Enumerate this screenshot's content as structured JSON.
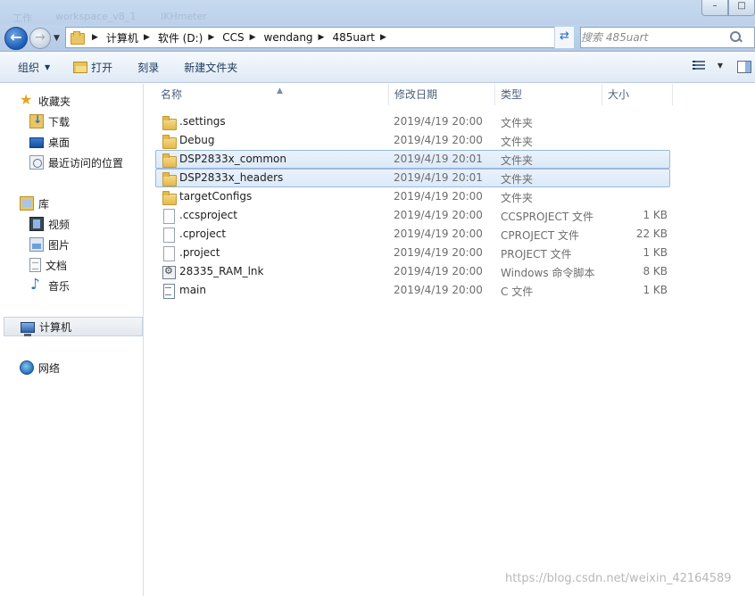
{
  "titlebar": {
    "faint_text": [
      "工作",
      "workspace_v8_1",
      "IKHmeter"
    ]
  },
  "window_controls": {
    "minimize": "–",
    "maximize": "□"
  },
  "address": {
    "breadcrumbs": [
      "计算机",
      "软件 (D:)",
      "CCS",
      "wendang",
      "485uart"
    ]
  },
  "search": {
    "placeholder": "搜索 485uart"
  },
  "toolbar": {
    "organize_label": "组织",
    "open_label": "打开",
    "burn_label": "刻录",
    "new_folder_label": "新建文件夹"
  },
  "sidebar": {
    "favorites_label": "收藏夹",
    "favorites": [
      "下载",
      "桌面",
      "最近访问的位置"
    ],
    "libraries_label": "库",
    "libraries": [
      "视频",
      "图片",
      "文档",
      "音乐"
    ],
    "computer_label": "计算机",
    "network_label": "网络"
  },
  "columns": {
    "name": "名称",
    "date": "修改日期",
    "type": "类型",
    "size": "大小"
  },
  "files": [
    {
      "name": ".settings",
      "date": "2019/4/19 20:00",
      "type": "文件夹",
      "size": "",
      "icon": "folder-icon",
      "selected": false
    },
    {
      "name": "Debug",
      "date": "2019/4/19 20:00",
      "type": "文件夹",
      "size": "",
      "icon": "folder-icon",
      "selected": false
    },
    {
      "name": "DSP2833x_common",
      "date": "2019/4/19 20:01",
      "type": "文件夹",
      "size": "",
      "icon": "folder-icon",
      "selected": true
    },
    {
      "name": "DSP2833x_headers",
      "date": "2019/4/19 20:01",
      "type": "文件夹",
      "size": "",
      "icon": "folder-icon",
      "selected": true
    },
    {
      "name": "targetConfigs",
      "date": "2019/4/19 20:00",
      "type": "文件夹",
      "size": "",
      "icon": "folder-icon",
      "selected": false
    },
    {
      "name": ".ccsproject",
      "date": "2019/4/19 20:00",
      "type": "CCSPROJECT 文件",
      "size": "1 KB",
      "icon": "page-icon",
      "selected": false
    },
    {
      "name": ".cproject",
      "date": "2019/4/19 20:00",
      "type": "CPROJECT 文件",
      "size": "22 KB",
      "icon": "page-icon",
      "selected": false
    },
    {
      "name": ".project",
      "date": "2019/4/19 20:00",
      "type": "PROJECT 文件",
      "size": "1 KB",
      "icon": "page-icon",
      "selected": false
    },
    {
      "name": "28335_RAM_lnk",
      "date": "2019/4/19 20:00",
      "type": "Windows 命令脚本",
      "size": "8 KB",
      "icon": "cmd-icon",
      "selected": false
    },
    {
      "name": "main",
      "date": "2019/4/19 20:00",
      "type": "C 文件",
      "size": "1 KB",
      "icon": "c-icon",
      "selected": false
    }
  ],
  "watermark": "https://blog.csdn.net/weixin_42164589"
}
